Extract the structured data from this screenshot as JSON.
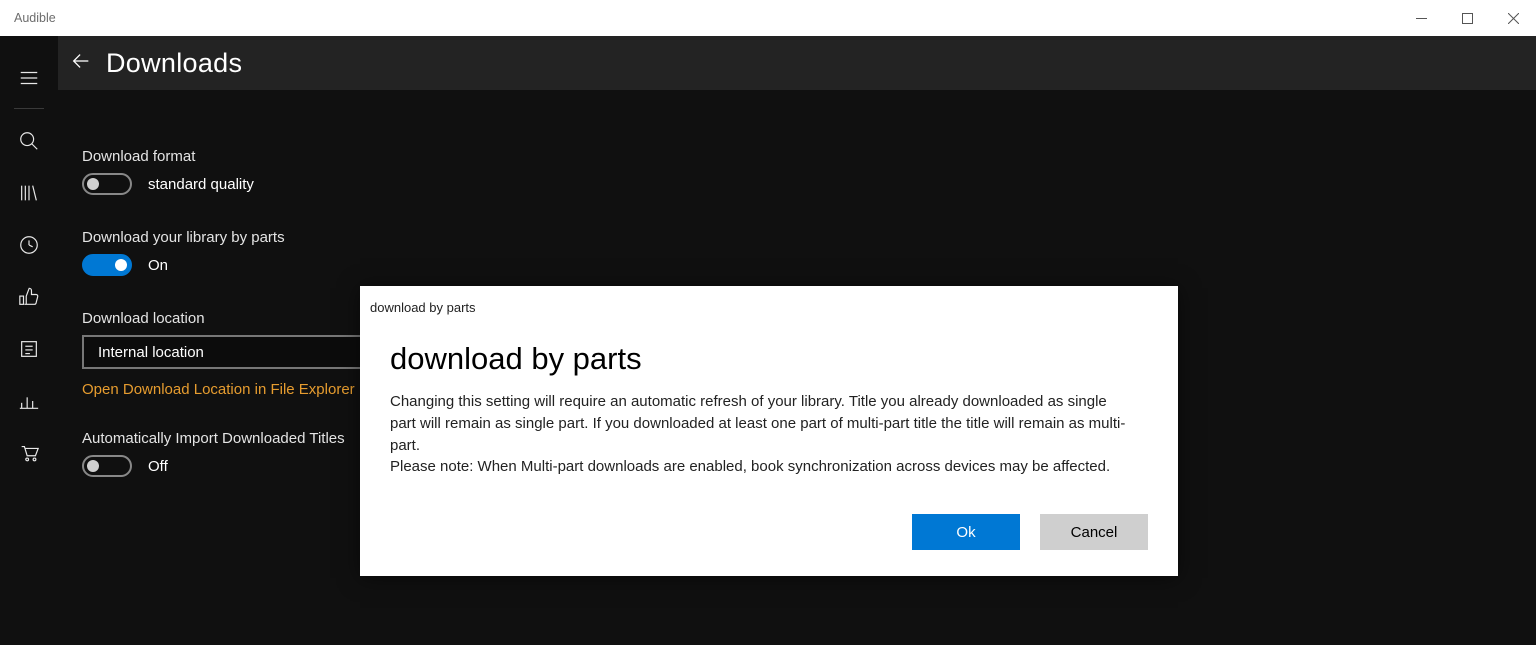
{
  "titlebar": {
    "app_name": "Audible"
  },
  "header": {
    "title": "Downloads"
  },
  "sidebar": {
    "items": [
      "menu",
      "search",
      "library",
      "clock",
      "thumbs-up",
      "notes",
      "stats",
      "cart"
    ]
  },
  "settings": {
    "format": {
      "label": "Download format",
      "toggle_state": "off",
      "value_text": "standard quality"
    },
    "by_parts": {
      "label": "Download your library by parts",
      "toggle_state": "on",
      "value_text": "On"
    },
    "location": {
      "label": "Download location",
      "selected": "Internal location",
      "link": "Open Download Location in File Explorer"
    },
    "auto_import": {
      "label": "Automatically Import Downloaded Titles",
      "toggle_state": "off",
      "value_text": "Off"
    }
  },
  "dialog": {
    "caption": "download by parts",
    "title": "download by parts",
    "body1": "Changing this setting will require an automatic refresh of your library. Title you already downloaded as single part will remain as single part. If you downloaded at least one part of multi-part title the title will remain as multi-part.",
    "body2": "Please note: When Multi-part downloads are enabled, book synchronization across devices may be affected.",
    "ok": "Ok",
    "cancel": "Cancel"
  }
}
